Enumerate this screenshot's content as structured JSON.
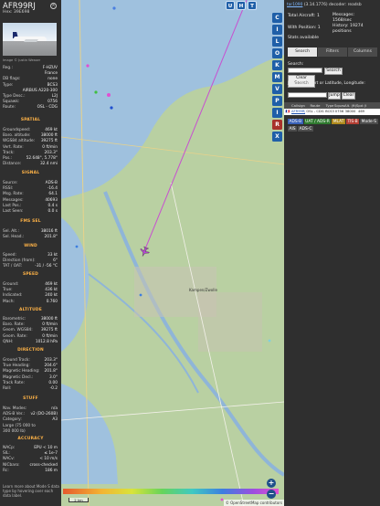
{
  "aircraft": {
    "callsign": "AFR99RJ",
    "hex_line": "Hex: 39E698",
    "photo_credit": "Image © Justin Wesser",
    "details": [
      {
        "k": "Reg.:",
        "v": "F-HZUV"
      },
      {
        "k": "",
        "v": "France"
      },
      {
        "k": "DB flags:",
        "v": "none"
      },
      {
        "k": "Type:",
        "v": "BCS3"
      },
      {
        "k": "",
        "v": "AIRBUS A220-300"
      },
      {
        "k": "Type Desc.:",
        "v": "L2J"
      },
      {
        "k": "Squawk:",
        "v": "0756"
      },
      {
        "k": "Route:",
        "v": "OSL - CDG"
      }
    ]
  },
  "sections": {
    "spatial": {
      "title": "SPATIAL",
      "rows": [
        {
          "k": "Groundspeed:",
          "v": "469 kt"
        },
        {
          "k": "Baro. altitude:",
          "v": "38000 ft"
        },
        {
          "k": "WGS84 altitude:",
          "v": "39275 ft"
        },
        {
          "k": "Vert. Rate:",
          "v": "0 ft/min"
        },
        {
          "k": "Track:",
          "v": "203.3°"
        },
        {
          "k": "Pos.:",
          "v": "52.648°, 5.778°"
        },
        {
          "k": "Distance:",
          "v": "32.4 nmi"
        }
      ]
    },
    "signal": {
      "title": "SIGNAL",
      "rows": [
        {
          "k": "Source:",
          "v": "ADS-B"
        },
        {
          "k": "RSSI:",
          "v": "-16.4"
        },
        {
          "k": "Msg. Rate:",
          "v": "64.1"
        },
        {
          "k": "Messages:",
          "v": "40693"
        },
        {
          "k": "Last Pos.:",
          "v": "0.4 s"
        },
        {
          "k": "Last Seen:",
          "v": "0.0 s"
        }
      ]
    },
    "fms": {
      "title": "FMS SEL",
      "rows": [
        {
          "k": "Sel. Alt.:",
          "v": "38016 ft"
        },
        {
          "k": "Sel. Head.:",
          "v": "201.8°"
        }
      ]
    },
    "wind": {
      "title": "WIND",
      "rows": [
        {
          "k": "Speed:",
          "v": "33 kt"
        },
        {
          "k": "Direction (from):",
          "v": "6°"
        },
        {
          "k": "TAT / OAT:",
          "v": "-31 / -56 °C"
        }
      ]
    },
    "speed": {
      "title": "SPEED",
      "rows": [
        {
          "k": "Ground:",
          "v": "469 kt"
        },
        {
          "k": "True:",
          "v": "436 kt"
        },
        {
          "k": "Indicated:",
          "v": "240 kt"
        },
        {
          "k": "Mach:",
          "v": "0.760"
        }
      ]
    },
    "altitude": {
      "title": "ALTITUDE",
      "rows": [
        {
          "k": "Barometric:",
          "v": "38000 ft"
        },
        {
          "k": "Baro. Rate:",
          "v": "0 ft/min"
        },
        {
          "k": "Geom. WGS84:",
          "v": "39275 ft"
        },
        {
          "k": "Geom. Rate:",
          "v": "0 ft/min"
        },
        {
          "k": "QNH:",
          "v": "1012.8 hPa"
        }
      ]
    },
    "direction": {
      "title": "DIRECTION",
      "rows": [
        {
          "k": "Ground Track:",
          "v": "203.3°"
        },
        {
          "k": "True Heading:",
          "v": "204.6°"
        },
        {
          "k": "Magnetic Heading:",
          "v": "201.8°"
        },
        {
          "k": "Magnetic Decl.:",
          "v": "3.0°"
        },
        {
          "k": "Track Rate:",
          "v": "0.00"
        },
        {
          "k": "Roll:",
          "v": "-0.2"
        }
      ]
    },
    "stuff": {
      "title": "STUFF",
      "rows": [
        {
          "k": "Nav. Modes:",
          "v": "n/a"
        },
        {
          "k": "ADS-B Ver.:",
          "v": "v2 (DO-260B)"
        },
        {
          "k": "Category:",
          "v": "A3"
        },
        {
          "k": "Large (75 000 to",
          "v": ""
        },
        {
          "k": "300 000 lb)",
          "v": ""
        }
      ]
    },
    "accuracy": {
      "title": "ACCURACY",
      "rows": [
        {
          "k": "NACp:",
          "v": "EPU < 10 m"
        },
        {
          "k": "SIL:",
          "v": "≤ 1e-7"
        },
        {
          "k": "NACv:",
          "v": "< 10 m/s"
        },
        {
          "k": "NICbaro:",
          "v": "cross-checked"
        },
        {
          "k": "Rc:",
          "v": "186 m"
        }
      ]
    }
  },
  "left_footer": "Learn more about Mode S data type by hovering over each data label.",
  "map": {
    "layer_buttons": [
      "U",
      "H",
      "T"
    ],
    "place_label": "Kampen/Zwolle",
    "scale": "2 km",
    "attribution": "© OpenStreetMap contributors",
    "zoom_in": "+",
    "zoom_out": "−",
    "colors": {
      "track": "#c84fd0",
      "water": "#9fc1de",
      "land": "#b9d0a2"
    }
  },
  "toolbar": [
    "C",
    "I",
    "L",
    "O",
    "K",
    "M",
    "V",
    "P",
    "I",
    "R",
    "X"
  ],
  "right": {
    "header_link": "tar1090",
    "header_rest": "(3.14.1776) decoder: readsb",
    "stats": {
      "total_label": "Total Aircraft:",
      "total_value": "1",
      "messages_label": "Messages:",
      "messages_value": "1568/sec",
      "positions_label": "With Position:",
      "positions_value": "1",
      "history_label": "History:",
      "history_value": "19274 positions",
      "stats_label": "Stats available"
    },
    "tabs": [
      "Search",
      "Filters",
      "Columns"
    ],
    "search_label": "Search:",
    "search_button": "Search",
    "clear_button": "Clear Search",
    "jump_label": "Jump to Airport or Latitude, Longitude:",
    "jump_button": "Jump",
    "jump_clear": "Clear",
    "table": {
      "headers": [
        "",
        "Callsign",
        "Route",
        "Type",
        "Squawk",
        "Alt. (ft)",
        "Spd (kt)",
        ""
      ],
      "rows": [
        [
          "",
          "AFR99RJ",
          "OSL - CDG",
          "BCS3",
          "0756",
          "38000",
          "469",
          ""
        ]
      ]
    },
    "badges": [
      {
        "label": "ADS-B",
        "color": "#3a62b8"
      },
      {
        "label": "UAT / ADS-R",
        "color": "#2f7a2f"
      },
      {
        "label": "MLAT",
        "color": "#b08a1d"
      },
      {
        "label": "TIS-B",
        "color": "#b33f34"
      },
      {
        "label": "Mode-S",
        "color": "#4d4d4d"
      },
      {
        "label": "AIS",
        "color": "#4d4d4d"
      },
      {
        "label": "ADS-C",
        "color": "#4d4d4d"
      }
    ]
  }
}
